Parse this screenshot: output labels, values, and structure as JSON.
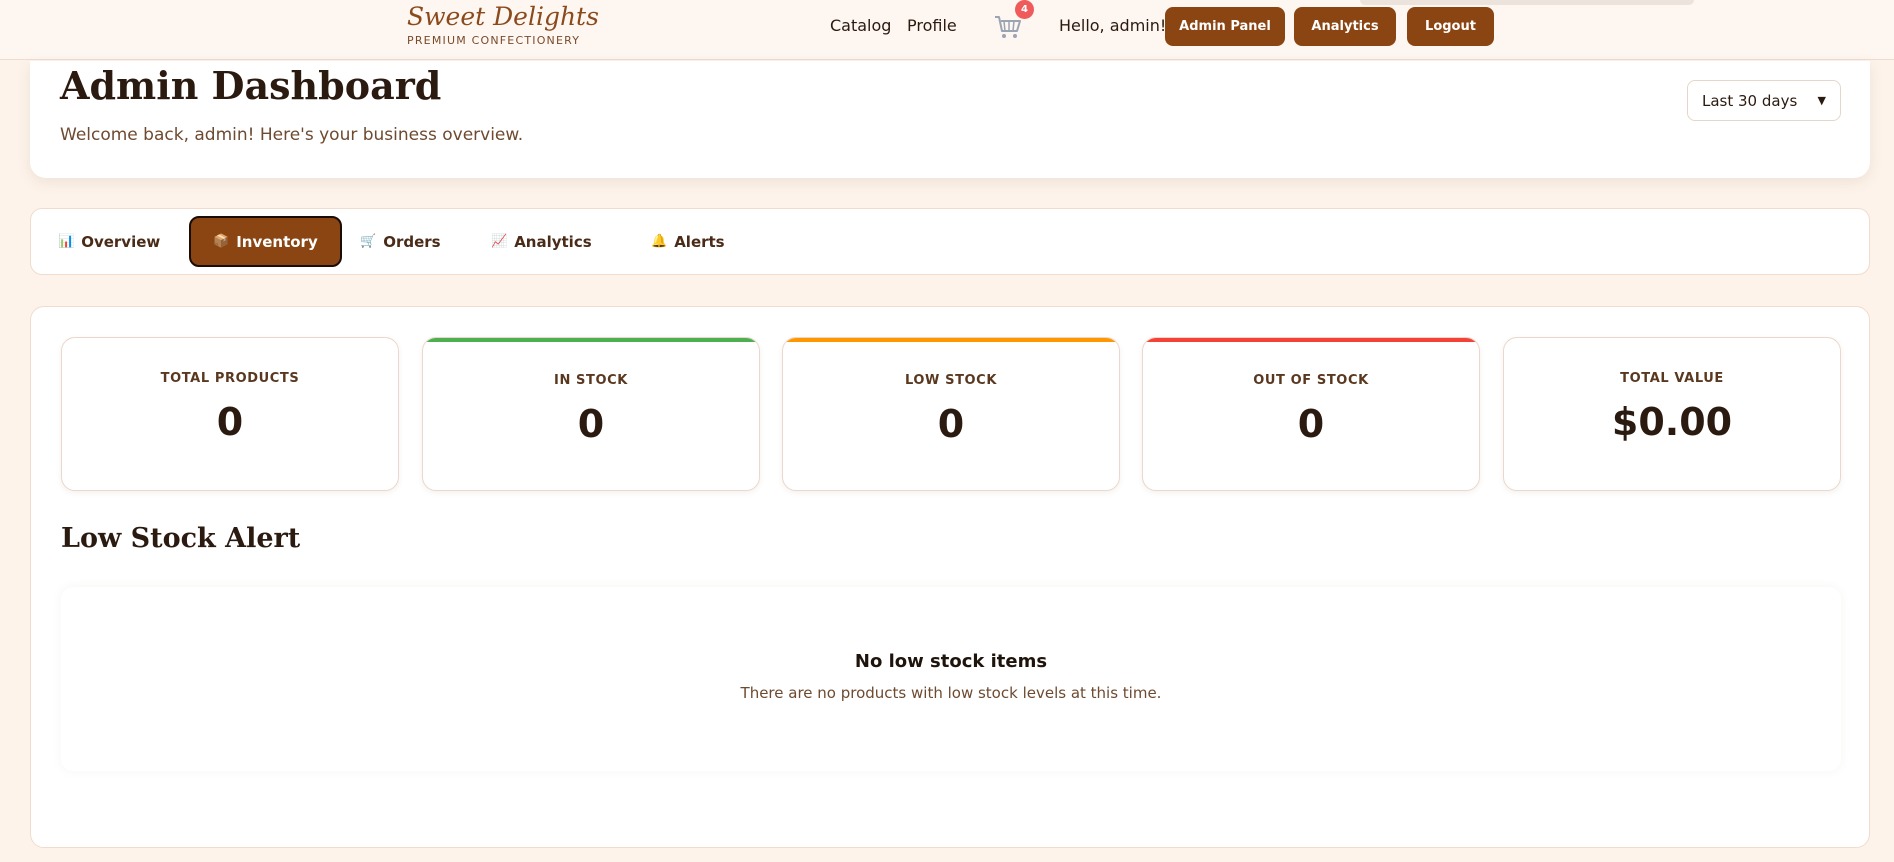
{
  "brand": {
    "name": "Sweet Delights",
    "tagline": "PREMIUM CONFECTIONERY"
  },
  "nav": {
    "links": [
      "Catalog",
      "Profile"
    ],
    "cart_count": "4",
    "greeting": "Hello, admin!",
    "buttons": [
      "Admin Panel",
      "Analytics",
      "Logout"
    ]
  },
  "header": {
    "title": "Admin Dashboard",
    "subtitle": "Welcome back, admin! Here's your business overview.",
    "range_selected": "Last 30 days"
  },
  "tabs": [
    {
      "icon": "📊",
      "label": "Overview",
      "active": false
    },
    {
      "icon": "📦",
      "label": "Inventory",
      "active": true
    },
    {
      "icon": "🛒",
      "label": "Orders",
      "active": false
    },
    {
      "icon": "📈",
      "label": "Analytics",
      "active": false
    },
    {
      "icon": "🔔",
      "label": "Alerts",
      "active": false
    }
  ],
  "stats": [
    {
      "label": "TOTAL PRODUCTS",
      "value": "0",
      "accent": ""
    },
    {
      "label": "IN STOCK",
      "value": "0",
      "accent": "#4caf50"
    },
    {
      "label": "LOW STOCK",
      "value": "0",
      "accent": "#ff9800"
    },
    {
      "label": "OUT OF STOCK",
      "value": "0",
      "accent": "#f44336"
    },
    {
      "label": "TOTAL VALUE",
      "value": "$0.00",
      "accent": ""
    }
  ],
  "low_stock": {
    "title": "Low Stock Alert",
    "empty_title": "No low stock items",
    "empty_text": "There are no products with low stock levels at this time."
  },
  "colors": {
    "primary": "#8b4513",
    "badge": "#ef5b5b",
    "background": "#fdf3ea"
  }
}
